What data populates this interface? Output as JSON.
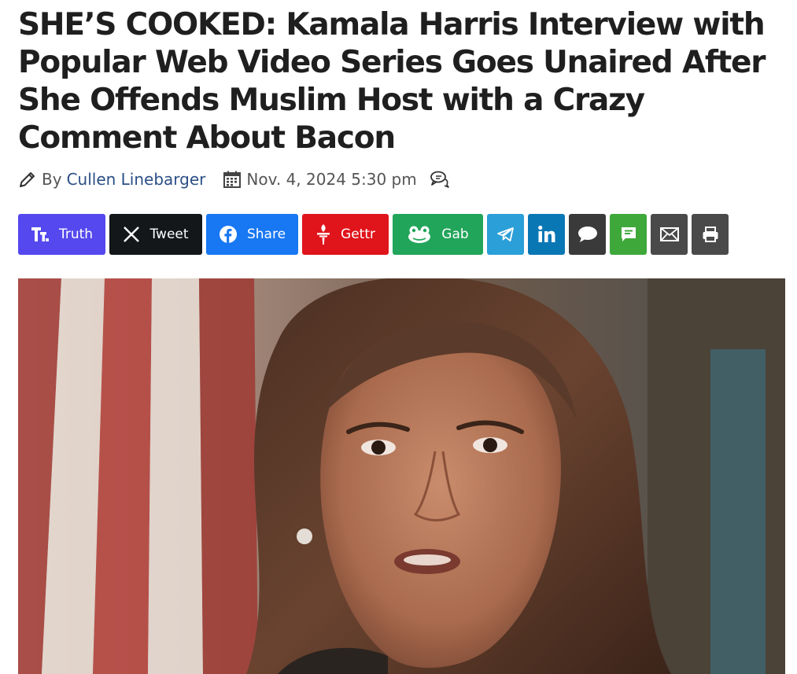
{
  "article": {
    "headline": "SHE’S COOKED: Kamala Harris Interview with Popular Web Video Series Goes Unaired After She Offends Muslim Host with a Crazy Comment About Bacon",
    "byline_prefix": "By",
    "author": "Cullen Linebarger",
    "date": "Nov. 4, 2024 5:30 pm"
  },
  "share_buttons": [
    {
      "label": "Truth",
      "icon": "truth-social-icon",
      "color": "#5448ee"
    },
    {
      "label": "Tweet",
      "icon": "x-icon",
      "color": "#14171a"
    },
    {
      "label": "Share",
      "icon": "facebook-icon",
      "color": "#1877f2"
    },
    {
      "label": "Gettr",
      "icon": "gettr-icon",
      "color": "#e0141b"
    },
    {
      "label": "Gab",
      "icon": "gab-frog-icon",
      "color": "#21a55a"
    },
    {
      "label": "",
      "icon": "telegram-icon",
      "color": "#2a9fd8"
    },
    {
      "label": "",
      "icon": "linkedin-icon",
      "color": "#0a77b5"
    },
    {
      "label": "",
      "icon": "comment-bubble-icon",
      "color": "#3a3a3a"
    },
    {
      "label": "",
      "icon": "sms-message-icon",
      "color": "#3ea83b"
    },
    {
      "label": "",
      "icon": "email-icon",
      "color": "#4a4a4a"
    },
    {
      "label": "",
      "icon": "print-icon",
      "color": "#4a4a4a"
    }
  ]
}
